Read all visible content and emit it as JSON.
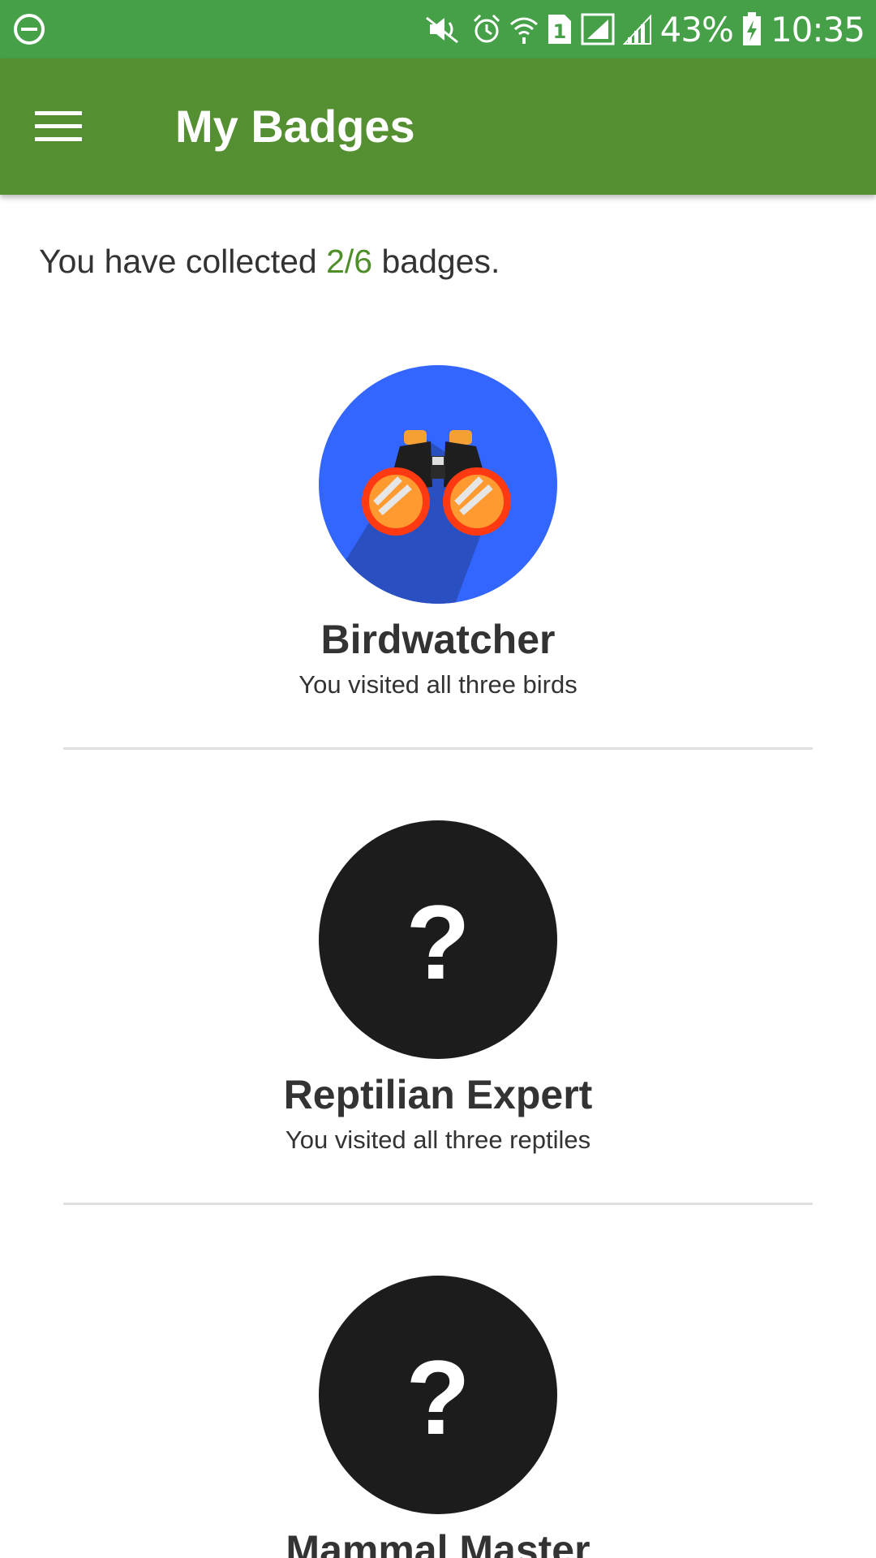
{
  "status_bar": {
    "battery": "43%",
    "time": "10:35",
    "sim_label": "1",
    "icons": [
      "dnd-icon",
      "mute-icon",
      "alarm-icon",
      "wifi-icon",
      "sim-icon",
      "signal-icon",
      "signal-icon",
      "battery-charging-icon"
    ]
  },
  "app_bar": {
    "title": "My Badges",
    "menu_icon": "hamburger-menu-icon"
  },
  "summary": {
    "prefix": "You have collected ",
    "count": "2/6",
    "suffix": " badges."
  },
  "badges": [
    {
      "name": "Birdwatcher",
      "description": "You visited all three birds",
      "state": "unlocked",
      "icon": "binoculars-icon"
    },
    {
      "name": "Reptilian Expert",
      "description": "You visited all three reptiles",
      "state": "locked",
      "icon": "question-mark-icon",
      "mark": "?"
    },
    {
      "name": "Mammal Master",
      "description": "",
      "state": "locked",
      "icon": "question-mark-icon",
      "mark": "?"
    }
  ],
  "colors": {
    "status_bar": "#45a048",
    "app_bar": "#548f31",
    "accent_count": "#4f8f2a",
    "badge_blue": "#3366ff",
    "locked_badge": "#1c1c1c"
  }
}
